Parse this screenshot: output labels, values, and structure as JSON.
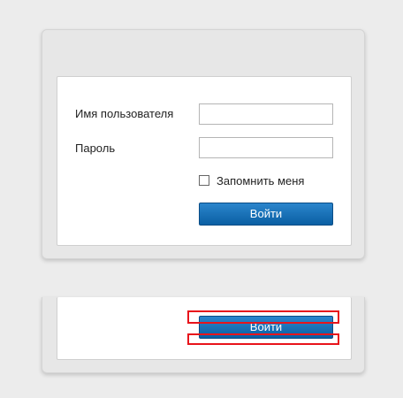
{
  "login_form": {
    "username_label": "Имя пользователя",
    "username_value": "",
    "password_label": "Пароль",
    "password_value": "",
    "remember_label": "Запомнить меня",
    "remember_checked": false,
    "submit_label": "Войти"
  },
  "lower_form": {
    "submit_label": "Войти"
  },
  "colors": {
    "button_blue": "#0a5fa3",
    "highlight_red": "#e8141b",
    "page_background": "#ececec"
  }
}
